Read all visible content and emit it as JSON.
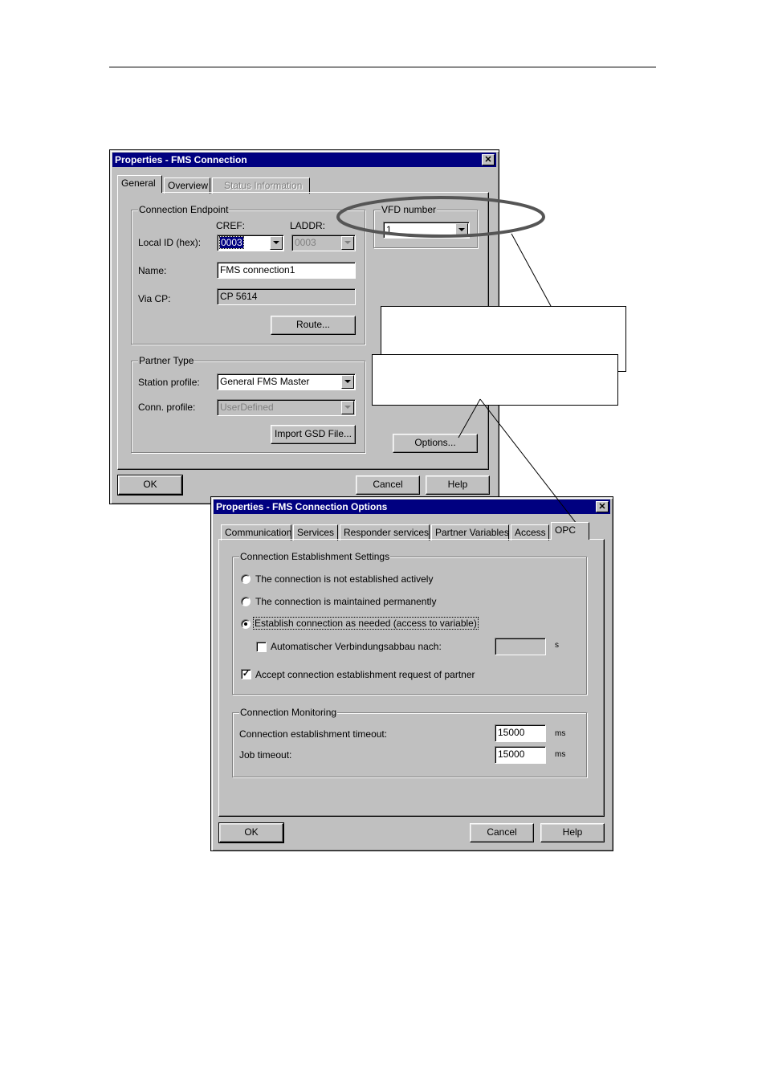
{
  "win1": {
    "title": "Properties - FMS Connection",
    "close": "✕",
    "tabs": [
      "General",
      "Overview",
      "Status Information"
    ],
    "endpoint": {
      "title": "Connection Endpoint",
      "cref_label": "CREF:",
      "laddr_label": "LADDR:",
      "local_id_label": "Local ID (hex):",
      "local_id_value": "0003",
      "laddr_value": "0003",
      "name_label": "Name:",
      "name_value": "FMS connection1",
      "via_label": "Via CP:",
      "via_value": "CP 5614",
      "route_button": "Route..."
    },
    "vfd": {
      "title": "VFD number",
      "value": "1"
    },
    "partner": {
      "title": "Partner Type",
      "station_label": "Station profile:",
      "station_value": "General FMS Master",
      "conn_label": "Conn. profile:",
      "conn_value": "UserDefined",
      "import_button": "Import GSD File..."
    },
    "options_button": "Options...",
    "ok": "OK",
    "cancel": "Cancel",
    "help": "Help"
  },
  "win2": {
    "title": "Properties - FMS Connection Options",
    "close": "✕",
    "tabs": [
      "Communication",
      "Services",
      "Responder services",
      "Partner Variables",
      "Access",
      "OPC"
    ],
    "establish": {
      "title": "Connection Establishment Settings",
      "opt1": "The connection is not established actively",
      "opt2": "The connection is maintained permanently",
      "opt3": "Establish connection as needed (access to variable)",
      "auto_label": "Automatischer Verbindungsabbau nach:",
      "auto_value": "",
      "auto_unit": "s",
      "accept_label": "Accept connection establishment request of partner"
    },
    "monitoring": {
      "title": "Connection Monitoring",
      "timeout_label": "Connection establishment timeout:",
      "timeout_value": "15000",
      "timeout_unit": "ms",
      "job_label": "Job timeout:",
      "job_value": "15000",
      "job_unit": "ms"
    },
    "ok": "OK",
    "cancel": "Cancel",
    "help": "Help"
  },
  "icons": {
    "check": "✓",
    "close": "close-icon",
    "dropdown": "chevron-down-icon"
  }
}
